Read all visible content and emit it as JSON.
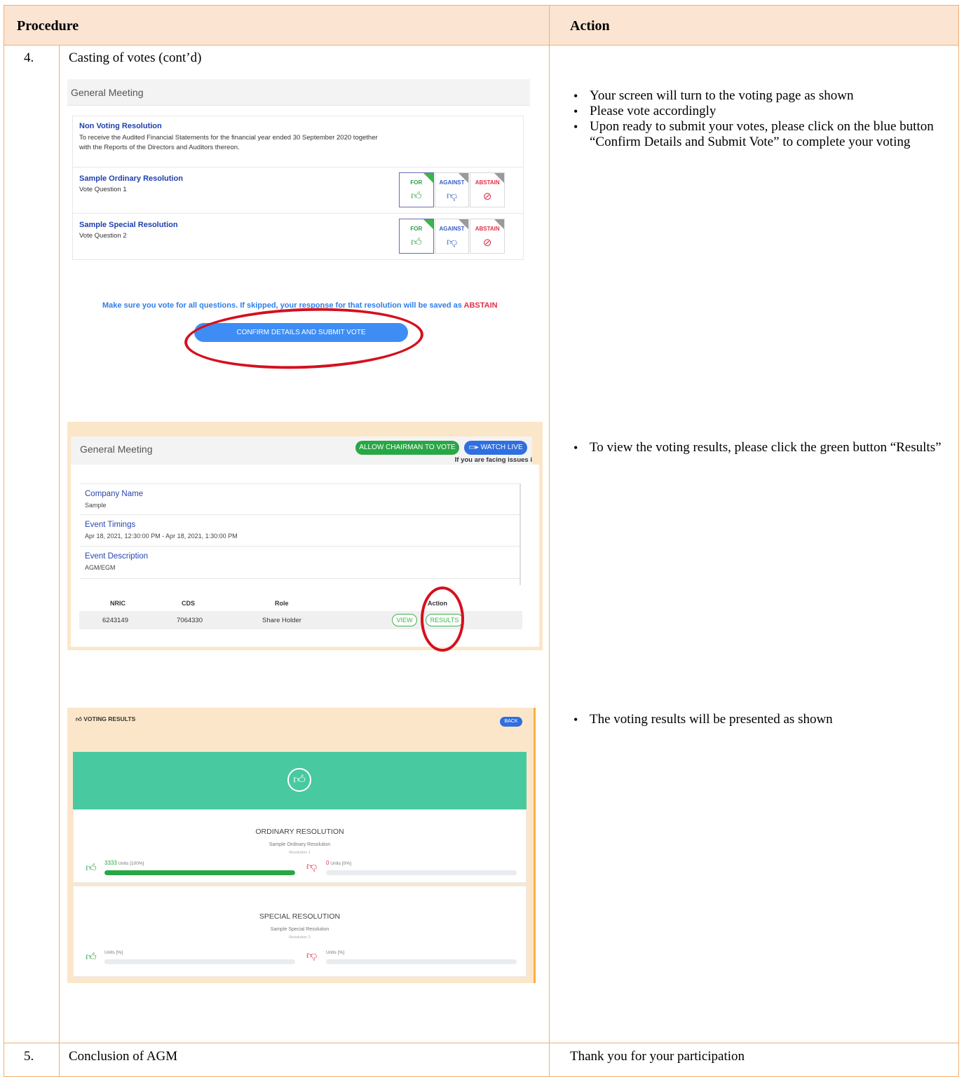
{
  "table": {
    "col_procedure": "Procedure",
    "col_action": "Action",
    "rows": [
      {
        "num": "4.",
        "title": "Casting of votes (cont’d)"
      },
      {
        "num": "5.",
        "title": "Conclusion of AGM",
        "action": "Thank you for your participation"
      }
    ],
    "bullets_group1": [
      "Your screen will turn to the voting page as shown",
      "Please vote accordingly",
      "Upon ready to submit your votes, please click on the blue button “Confirm Details and Submit Vote” to complete your voting"
    ],
    "bullets_group2": [
      "To view the voting results, please click the green button “Results”"
    ],
    "bullets_group3": [
      "The voting results will be presented as shown"
    ]
  },
  "voting_page": {
    "header": "General Meeting",
    "non_voting": {
      "title": "Non Voting Resolution",
      "desc": "To receive the Audited Financial Statements for the financial year ended 30 September 2020 together with the Reports of the Directors and Auditors thereon."
    },
    "resolutions": [
      {
        "title": "Sample Ordinary Resolution",
        "question": "Vote Question 1"
      },
      {
        "title": "Sample Special Resolution",
        "question": "Vote Question 2"
      }
    ],
    "vote_labels": {
      "for": "FOR",
      "against": "AGAINST",
      "abstain": "ABSTAIN"
    },
    "warning": "Make sure you vote for all questions. If skipped, your response for that resolution will be saved as ",
    "warning_highlight": "ABSTAIN",
    "confirm_button": "CONFIRM DETAILS AND SUBMIT VOTE"
  },
  "event_page": {
    "header": "General Meeting",
    "allow_chairman": "ALLOW CHAIRMAN TO VOTE",
    "watch_live": "WATCH LIVE",
    "facing_issues": "If you are facing issues i",
    "company_label": "Company Name",
    "company_value": "Sample",
    "timings_label": "Event Timings",
    "timings_value": "Apr 18, 2021, 12:30:00 PM - Apr 18, 2021, 1:30:00 PM",
    "desc_label": "Event Description",
    "desc_value": "AGM/EGM",
    "columns": [
      "NRIC",
      "CDS",
      "Role",
      "Action"
    ],
    "row": {
      "nric": "6243149",
      "cds": "7064330",
      "role": "Share Holder"
    },
    "view_button": "VIEW",
    "results_button": "RESULTS"
  },
  "results_page": {
    "title": "VOTING RESULTS",
    "back": "BACK",
    "cards": [
      {
        "heading": "ORDINARY RESOLUTION",
        "name": "Sample Ordinary Resolution",
        "sub": "Resolution 1",
        "for_units": "3333",
        "for_label": "Units [100%]",
        "for_fraction": 1.0,
        "against_units": "0",
        "against_label": "Units [0%]",
        "against_fraction": 0
      },
      {
        "heading": "SPECIAL RESOLUTION",
        "name": "Sample Special Resolution",
        "sub": "Resolution 2",
        "for_units": "",
        "for_label": "Units [%]",
        "for_fraction": 0,
        "against_units": "",
        "against_label": "Units [%]",
        "against_fraction": 0
      }
    ]
  },
  "colors": {
    "header_bg": "#fbe4d2",
    "border": "#f0b070",
    "primary_blue": "#3d8df5",
    "success_green": "#28a745",
    "band_green": "#48c9a0",
    "danger_red": "#e1324a",
    "highlight_red": "#d4101e"
  },
  "icons": {
    "thumbs_up": "thumbs-up-icon",
    "thumbs_down": "thumbs-down-icon",
    "abstain": "no-entry-icon",
    "video": "video-icon"
  }
}
